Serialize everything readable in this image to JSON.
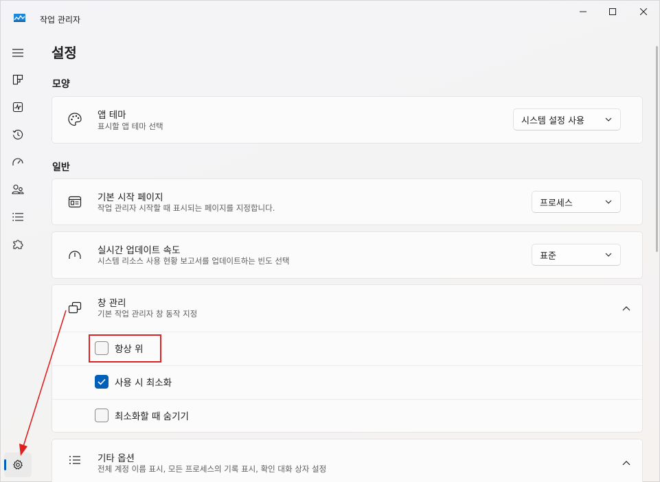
{
  "window": {
    "title": "작업 관리자"
  },
  "colors": {
    "accent": "#005fb8",
    "annotation": "#e02020"
  },
  "nav": {
    "items": [
      {
        "name": "menu",
        "icon": "hamburger-icon"
      },
      {
        "name": "processes",
        "icon": "processes-icon"
      },
      {
        "name": "performance",
        "icon": "performance-icon"
      },
      {
        "name": "app-history",
        "icon": "history-icon"
      },
      {
        "name": "startup-apps",
        "icon": "speedometer-icon"
      },
      {
        "name": "users",
        "icon": "users-icon"
      },
      {
        "name": "details",
        "icon": "list-icon"
      },
      {
        "name": "services",
        "icon": "puzzle-icon"
      },
      {
        "name": "settings",
        "icon": "gear-icon",
        "active": true
      }
    ]
  },
  "page": {
    "title": "설정"
  },
  "appearance": {
    "section_title": "모양",
    "theme": {
      "title": "앱 테마",
      "subtitle": "표시할 앱 테마 선택",
      "value": "시스템 설정 사용"
    }
  },
  "general": {
    "section_title": "일반",
    "default_page": {
      "title": "기본 시작 페이지",
      "subtitle": "작업 관리자 시작할 때 표시되는 페이지를 지정합니다.",
      "value": "프로세스"
    },
    "update_speed": {
      "title": "실시간 업데이트 속도",
      "subtitle": "시스템 리소스 사용 현황 보고서를 업데이트하는 빈도 선택",
      "value": "표준"
    },
    "window_management": {
      "title": "창 관리",
      "subtitle": "기본 작업 관리자 창 동작 지정",
      "options": [
        {
          "label": "항상 위",
          "checked": false
        },
        {
          "label": "사용 시 최소화",
          "checked": true
        },
        {
          "label": "최소화할 때 숨기기",
          "checked": false
        }
      ]
    },
    "other_options": {
      "title": "기타 옵션",
      "subtitle": "전체 계정 이름 표시, 모든 프로세스의 기록 표시, 확인 대화 상자 설정"
    }
  }
}
